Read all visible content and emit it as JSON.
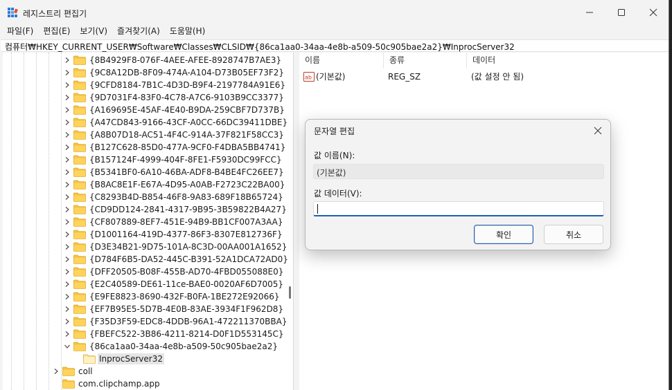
{
  "window": {
    "title": "레지스트리 편집기"
  },
  "menu": [
    "파일(F)",
    "편집(E)",
    "보기(V)",
    "즐겨찾기(A)",
    "도움말(H)"
  ],
  "address": "컴퓨터₩HKEY_CURRENT_USER₩Software₩Classes₩CLSID₩{86ca1aa0-34aa-4e8b-a509-50c905bae2a2}₩InprocServer32",
  "tree": {
    "items": [
      {
        "label": "{8B4929F8-076F-4AEE-AFEE-8928747B7AE3}",
        "expander": "collapsed"
      },
      {
        "label": "{9C8A12DB-8F09-474A-A104-D73B05EF73F2}",
        "expander": "collapsed"
      },
      {
        "label": "{9CFD8184-7B1C-4D3D-B9F4-2197784A91E6}",
        "expander": "collapsed"
      },
      {
        "label": "{9D7031F4-83F0-4C78-A7C6-9103B9CC3377}",
        "expander": "collapsed"
      },
      {
        "label": "{A169695E-45AF-4E40-B9DA-259CBF7D737B}",
        "expander": "collapsed"
      },
      {
        "label": "{A47CD843-9166-43CF-A0CC-66DC39411DBE}",
        "expander": "collapsed"
      },
      {
        "label": "{A8B07D18-AC51-4F4C-914A-37F821F58CC3}",
        "expander": "collapsed"
      },
      {
        "label": "{B127C628-85D0-477A-9CF0-F4DBA5BB4741}",
        "expander": "collapsed"
      },
      {
        "label": "{B157124F-4999-404F-8FE1-F5930DC99FCC}",
        "expander": "collapsed"
      },
      {
        "label": "{B5341BF0-6A10-46BA-ADF8-B4BE4FC26EE7}",
        "expander": "collapsed"
      },
      {
        "label": "{B8AC8E1F-E67A-4D95-A0AB-F2723C22BA00}",
        "expander": "collapsed"
      },
      {
        "label": "{C8293B4D-B854-46F8-9A83-689F18B65724}",
        "expander": "collapsed"
      },
      {
        "label": "{CD9DD124-2841-4317-9B95-3B59822B4A27}",
        "expander": "collapsed"
      },
      {
        "label": "{CF807889-8EF7-451E-94B9-BB1CF007A3AA}",
        "expander": "collapsed"
      },
      {
        "label": "{D1001164-419D-4377-86F3-8307E812736F}",
        "expander": "collapsed"
      },
      {
        "label": "{D3E34B21-9D75-101A-8C3D-00AA001A1652}",
        "expander": "collapsed"
      },
      {
        "label": "{D784F6B5-DA52-445C-B391-52A1DCA72AD0}",
        "expander": "collapsed"
      },
      {
        "label": "{DFF20505-B08F-455B-AD70-4FBD055088E0}",
        "expander": "collapsed"
      },
      {
        "label": "{E2C40589-DE61-11ce-BAE0-0020AF6D7005}",
        "expander": "collapsed"
      },
      {
        "label": "{E9FE8823-8690-432F-B0FA-1BE272E92066}",
        "expander": "collapsed"
      },
      {
        "label": "{EF7B95E5-5D7B-4E0B-83AE-3934F1F962D8}",
        "expander": "collapsed"
      },
      {
        "label": "{F35D3F59-EDC8-4DDB-96A1-472211370BBA}",
        "expander": "collapsed"
      },
      {
        "label": "{FBEFC522-3B86-4211-8214-D0F1D553145C}",
        "expander": "collapsed"
      },
      {
        "label": "{86ca1aa0-34aa-4e8b-a509-50c905bae2a2}",
        "expander": "expanded"
      },
      {
        "label": "InprocServer32",
        "expander": "none",
        "selected": true
      },
      {
        "label": "coll",
        "expander": "collapsed"
      },
      {
        "label": "com.clipchamp.app",
        "expander": "none"
      }
    ]
  },
  "list": {
    "columns": [
      "이름",
      "종류",
      "데이터"
    ],
    "rows": [
      {
        "name": "(기본값)",
        "type": "REG_SZ",
        "data": "(값 설정 안 됨)",
        "icon": "string-value-icon"
      }
    ]
  },
  "dialog": {
    "title": "문자열 편집",
    "name_label": "값 이름(N):",
    "name_value": "(기본값)",
    "data_label": "값 데이터(V):",
    "data_value": "",
    "ok_label": "확인",
    "cancel_label": "취소"
  },
  "colors": {
    "folder": "#f5c542",
    "accent": "#1a5fb4",
    "selection": "#e5e5e5"
  }
}
